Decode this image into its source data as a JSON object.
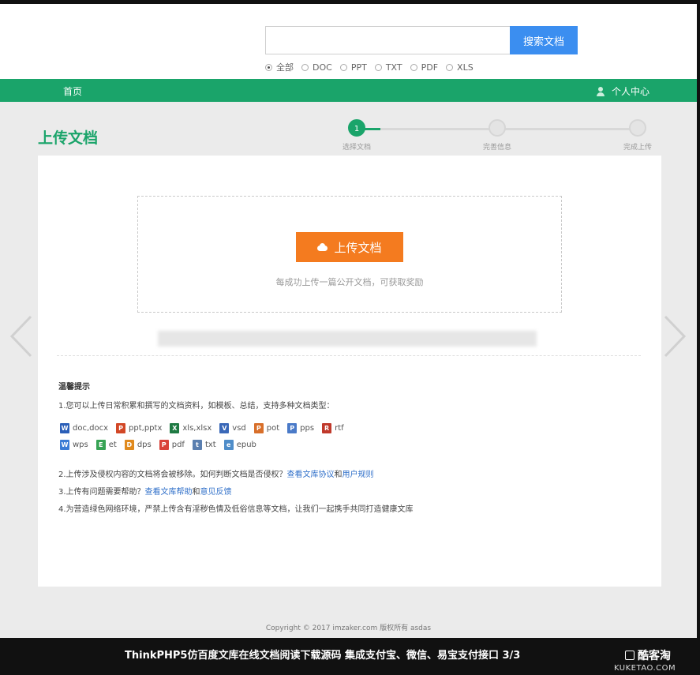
{
  "search": {
    "placeholder": "",
    "button": "搜索文档"
  },
  "filters": [
    {
      "label": "全部",
      "selected": true
    },
    {
      "label": "DOC",
      "selected": false
    },
    {
      "label": "PPT",
      "selected": false
    },
    {
      "label": "TXT",
      "selected": false
    },
    {
      "label": "PDF",
      "selected": false
    },
    {
      "label": "XLS",
      "selected": false
    }
  ],
  "nav": {
    "home": "首页",
    "user_center": "个人中心"
  },
  "page_title": "上传文档",
  "steps": [
    {
      "num": "1",
      "label": "选择文档"
    },
    {
      "num": "",
      "label": "完善信息"
    },
    {
      "num": "",
      "label": "完成上传"
    }
  ],
  "upload": {
    "button": "上传文档",
    "hint": "每成功上传一篇公开文档，可获取奖励"
  },
  "tips": {
    "title": "温馨提示",
    "line1": "1.您可以上传日常积累和撰写的文档资料，如模板、总结，支持多种文档类型：",
    "types": [
      {
        "label": "doc,docx",
        "icon": "word-icon",
        "color": "#2b5fb8",
        "glyph": "W"
      },
      {
        "label": "ppt,pptx",
        "icon": "ppt-icon",
        "color": "#d24726",
        "glyph": "P"
      },
      {
        "label": "xls,xlsx",
        "icon": "excel-icon",
        "color": "#1f7a43",
        "glyph": "X"
      },
      {
        "label": "vsd",
        "icon": "visio-icon",
        "color": "#3a68b8",
        "glyph": "V"
      },
      {
        "label": "pot",
        "icon": "pot-icon",
        "color": "#d86f2a",
        "glyph": "P"
      },
      {
        "label": "pps",
        "icon": "pps-icon",
        "color": "#4a7ac8",
        "glyph": "P"
      },
      {
        "label": "rtf",
        "icon": "rtf-icon",
        "color": "#c0392b",
        "glyph": "R"
      },
      {
        "label": "wps",
        "icon": "wps-icon",
        "color": "#3a7bd5",
        "glyph": "W"
      },
      {
        "label": "et",
        "icon": "et-icon",
        "color": "#37a354",
        "glyph": "E"
      },
      {
        "label": "dps",
        "icon": "dps-icon",
        "color": "#e08a1e",
        "glyph": "D"
      },
      {
        "label": "pdf",
        "icon": "pdf-icon",
        "color": "#d9423a",
        "glyph": "P"
      },
      {
        "label": "txt",
        "icon": "txt-icon",
        "color": "#5a7fb0",
        "glyph": "t"
      },
      {
        "label": "epub",
        "icon": "epub-icon",
        "color": "#4f8dc9",
        "glyph": "e"
      }
    ],
    "line2": "2.上传涉及侵权内容的文档将会被移除。如何判断文档是否侵权？",
    "line2_link_a": "查看文库协议",
    "line2_link_and": "和",
    "line2_link_b": "用户规则",
    "line3": "3.上传有问题需要帮助？",
    "line3_link_a": "查看文库帮助",
    "line3_link_and": "和",
    "line3_link_b": "意见反馈",
    "line4": "4.为营造绿色网络环境，严禁上传含有淫秽色情及低俗信息等文档，让我们一起携手共同打造健康文库"
  },
  "copyright": "Copyright © 2017 imzaker.com 版权所有 asdas",
  "caption": {
    "text": "ThinkPHP5仿百度文库在线文档阅读下载源码 集成支付宝、微信、易宝支付接口   3/3",
    "brand": "酷客淘",
    "brand_sub": "KUKETAO.COM"
  }
}
